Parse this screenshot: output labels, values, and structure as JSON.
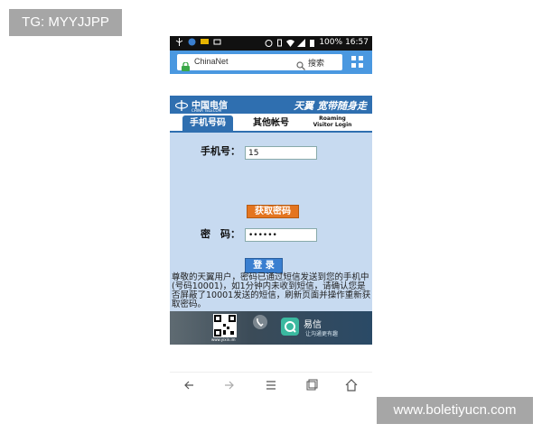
{
  "overlay": {
    "tag": "TG: MYYJJPP",
    "watermark": "www.boletiyucn.com"
  },
  "status_bar": {
    "battery": "100%",
    "time": "16:57"
  },
  "browser": {
    "url": "ChinaNet",
    "search_label": "搜索"
  },
  "portal": {
    "brand_cn": "中国电信",
    "brand_en": "CHINA TELECOM",
    "slogan": "天翼 宽带随身走",
    "tabs": [
      {
        "label": "手机号码",
        "active": true
      },
      {
        "label": "其他帐号",
        "active": false
      }
    ],
    "roaming_tab": {
      "line1": "Roaming",
      "line2": "Visitor Login"
    },
    "phone_label": "手机号：",
    "phone_value": "15",
    "get_code_button": "获取密码",
    "password_label": "密　码：",
    "password_value": "••••••",
    "login_button": "登 录",
    "notice": "尊敬的天翼用户，密码已通过短信发送到您的手机中(号码10001)，如1分钟内未收到短信，请确认您是否屏蔽了10001发送的短信，刷新页面并操作重新获取密码。"
  },
  "banner": {
    "qr_url": "www.yixin.im",
    "app_name": "易信",
    "app_slogan": "让沟通更有趣"
  }
}
